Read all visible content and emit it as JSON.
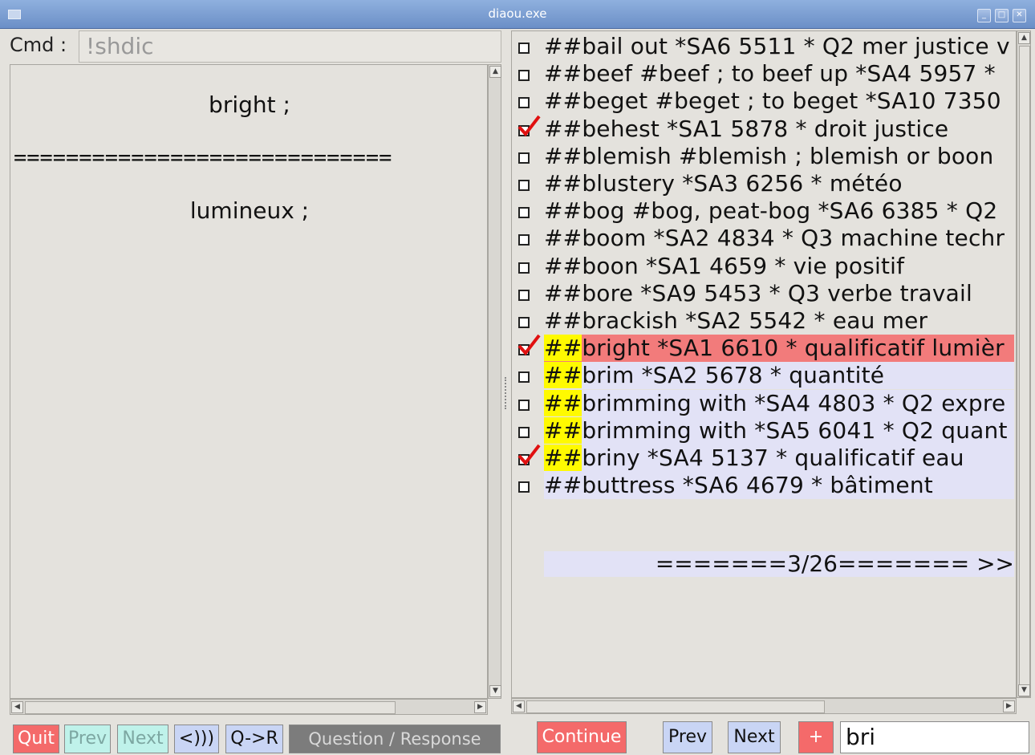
{
  "window": {
    "title": "diaou.exe"
  },
  "left": {
    "cmd_label": "Cmd :",
    "cmd_value": "!shdic",
    "question": "bright ;",
    "separator": "=============================",
    "answer": "lumineux ;"
  },
  "left_buttons": {
    "quit": "Quit",
    "prev": "Prev",
    "next": "Next",
    "sound": "<)))",
    "qr": "Q->R",
    "mode": "Question / Response"
  },
  "entries": [
    {
      "prefix": "##",
      "text": "bail out *SA6 5511 * Q2 mer justice v",
      "checked": false,
      "marked": false,
      "state": "normal"
    },
    {
      "prefix": "##",
      "text": "beef #beef ; to beef up *SA4 5957 *",
      "checked": false,
      "marked": false,
      "state": "normal"
    },
    {
      "prefix": "##",
      "text": "beget #beget ; to beget *SA10 7350",
      "checked": false,
      "marked": false,
      "state": "normal"
    },
    {
      "prefix": "##",
      "text": "behest *SA1 5878 * droit justice",
      "checked": true,
      "marked": false,
      "state": "normal"
    },
    {
      "prefix": "##",
      "text": "blemish #blemish ; blemish or boon",
      "checked": false,
      "marked": false,
      "state": "normal"
    },
    {
      "prefix": "##",
      "text": "blustery *SA3 6256 * météo",
      "checked": false,
      "marked": false,
      "state": "normal"
    },
    {
      "prefix": "##",
      "text": "bog #bog, peat-bog *SA6 6385 * Q2",
      "checked": false,
      "marked": false,
      "state": "normal"
    },
    {
      "prefix": "##",
      "text": "boom *SA2 4834 * Q3 machine techr",
      "checked": false,
      "marked": false,
      "state": "normal"
    },
    {
      "prefix": "##",
      "text": "boon *SA1 4659 * vie positif",
      "checked": false,
      "marked": false,
      "state": "normal"
    },
    {
      "prefix": "##",
      "text": "bore *SA9 5453 * Q3 verbe travail",
      "checked": false,
      "marked": false,
      "state": "normal"
    },
    {
      "prefix": "##",
      "text": "brackish *SA2 5542 * eau mer",
      "checked": false,
      "marked": false,
      "state": "normal"
    },
    {
      "prefix": "##",
      "text": "bright *SA1 6610 * qualificatif lumièr",
      "checked": true,
      "marked": true,
      "state": "selected"
    },
    {
      "prefix": "##",
      "text": "brim *SA2 5678 * quantité",
      "checked": false,
      "marked": true,
      "state": "highlight"
    },
    {
      "prefix": "##",
      "text": "brimming with *SA4 4803 * Q2 expre",
      "checked": false,
      "marked": true,
      "state": "highlight"
    },
    {
      "prefix": "##",
      "text": "brimming with *SA5 6041 * Q2 quant",
      "checked": false,
      "marked": true,
      "state": "highlight"
    },
    {
      "prefix": "##",
      "text": "briny *SA4 5137 * qualificatif eau",
      "checked": true,
      "marked": true,
      "state": "highlight"
    },
    {
      "prefix": "##",
      "text": "buttress *SA6 4679 * bâtiment",
      "checked": false,
      "marked": false,
      "state": "highlight"
    }
  ],
  "pager": "=======3/26======= >>",
  "right_buttons": {
    "continue": "Continue",
    "prev": "Prev",
    "next": "Next",
    "plus": "+",
    "search_value": "bri"
  },
  "colors": {
    "selected_row": "#f27b7b",
    "highlight_row": "#e2e2f6",
    "marker": "#fffa00",
    "checkmark": "#e01010"
  },
  "icons": [
    "window-icon",
    "minimize-icon",
    "maximize-icon",
    "close-icon",
    "checkmark-icon",
    "scroll-up-icon",
    "scroll-down-icon",
    "scroll-left-icon",
    "scroll-right-icon"
  ]
}
